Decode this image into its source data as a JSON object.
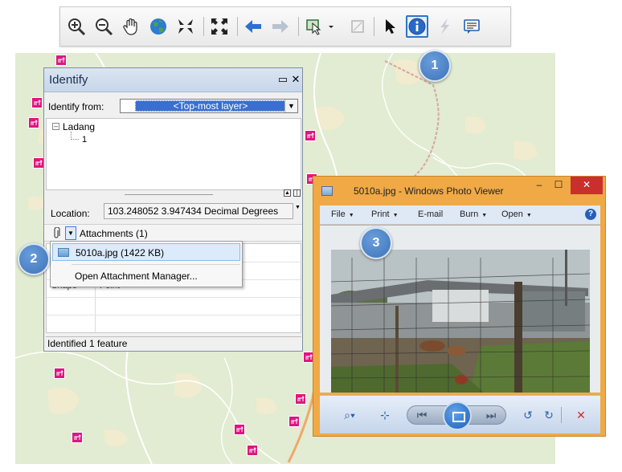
{
  "identify": {
    "title": "Identify",
    "from_label": "Identify from:",
    "from_value": "<Top-most layer>",
    "tree_root": "Ladang",
    "tree_child": "1",
    "location_label": "Location:",
    "location_value": "103.248052  3.947434 Decimal Degrees",
    "attachments_label": "Attachments (1)",
    "grid_cell_a": "Shape",
    "grid_cell_b": "Point",
    "status": "Identified 1 feature"
  },
  "attachment_menu": {
    "file_item": "5010a.jpg (1422 KB)",
    "manager_item": "Open Attachment Manager..."
  },
  "viewer": {
    "title": "5010a.jpg - Windows Photo Viewer",
    "menu": [
      "File",
      "Print",
      "E-mail",
      "Burn",
      "Open"
    ],
    "help": "?",
    "minimize": "–",
    "maximize": "☐",
    "close": "✕"
  },
  "callouts": [
    "1",
    "2",
    "3"
  ],
  "icons": [
    "zoom-in-icon",
    "zoom-out-icon",
    "pan-hand-icon",
    "globe-full-extent-icon",
    "fixed-zoom-in-icon",
    "fixed-zoom-out-icon",
    "back-arrow-icon",
    "forward-arrow-icon",
    "select-features-icon",
    "clear-selection-icon",
    "select-elements-icon",
    "identify-icon",
    "hyperlink-icon",
    "html-popup-icon"
  ],
  "colors": {
    "poi": "#e0157f",
    "map_bg": "#e1ecd2",
    "callout": "#3d73b8",
    "viewer_frame": "#f0a945"
  }
}
